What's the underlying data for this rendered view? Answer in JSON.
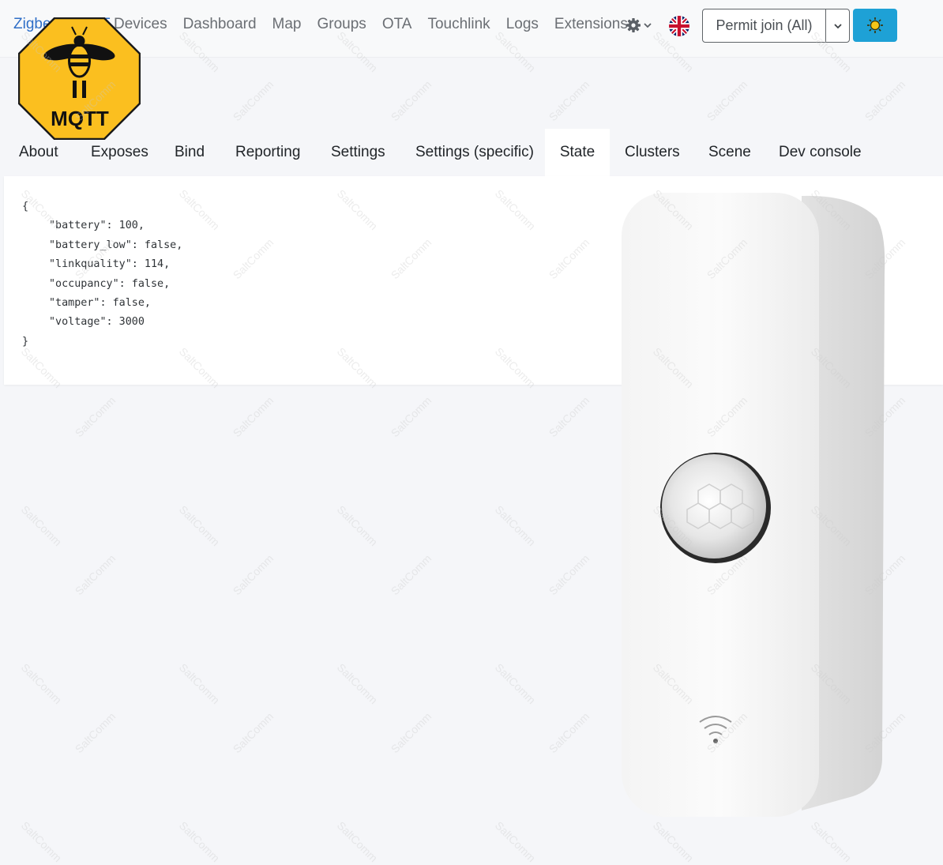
{
  "navbar": {
    "brand": "Zigbee2MQTT",
    "links": [
      "Devices",
      "Dashboard",
      "Map",
      "Groups",
      "OTA",
      "Touchlink",
      "Logs",
      "Extensions"
    ],
    "settings_icon": "gear-icon",
    "language_icon": "uk-flag-icon",
    "permit_join_label": "Permit join (All)",
    "permit_join_caret_icon": "chevron-down-icon",
    "theme_icon": "sun-icon",
    "theme_button_color": "#1ea1d6"
  },
  "logo": {
    "text": "MQTT",
    "icon": "bee-icon",
    "color": "#fbbf1f"
  },
  "tabs": [
    "About",
    "Exposes",
    "Bind",
    "Reporting",
    "Settings",
    "Settings (specific)",
    "State",
    "Clusters",
    "Scene",
    "Dev console"
  ],
  "active_tab": "State",
  "state": {
    "open": "{",
    "lines": [
      "\"battery\": 100,",
      "\"battery_low\": false,",
      "\"linkquality\": 114,",
      "\"occupancy\": false,",
      "\"tamper\": false,",
      "\"voltage\": 3000"
    ],
    "close": "}"
  },
  "watermark_text": "SaltComm",
  "product_image": {
    "name": "pir-motion-sensor-photo",
    "icon": "wifi-signal-icon"
  }
}
